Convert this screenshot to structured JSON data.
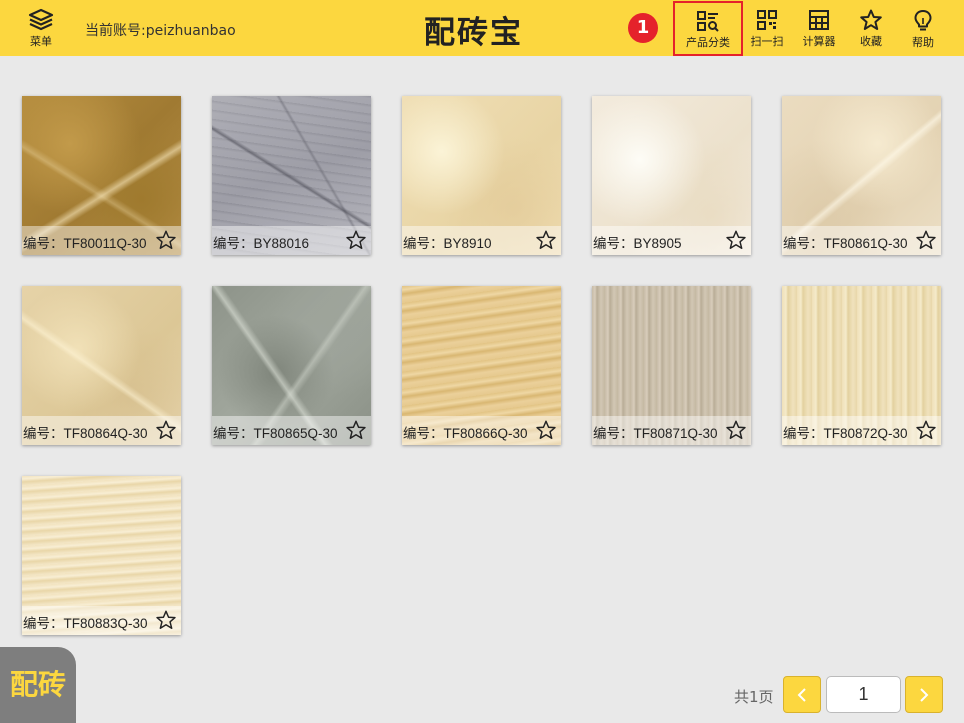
{
  "header": {
    "menu_label": "菜单",
    "account_text": "当前账号:peizhuanbao",
    "app_title": "配砖宝",
    "step_badge": "1",
    "tools": [
      {
        "label": "产品分类",
        "icon": "category-search-icon"
      },
      {
        "label": "扫一扫",
        "icon": "qr-scan-icon"
      },
      {
        "label": "计算器",
        "icon": "calculator-icon"
      },
      {
        "label": "收藏",
        "icon": "star-icon"
      },
      {
        "label": "帮助",
        "icon": "lightbulb-icon"
      }
    ],
    "highlight_color": "#e5222b",
    "bar_color": "#fcd73f"
  },
  "products": [
    {
      "code": "编号：TF80011Q-30",
      "texture": "dark-gold-marble"
    },
    {
      "code": "编号：BY88016",
      "texture": "grey-veined-marble"
    },
    {
      "code": "编号：BY8910",
      "texture": "cream-marble"
    },
    {
      "code": "编号：BY8905",
      "texture": "light-cream-marble"
    },
    {
      "code": "编号：TF80861Q-30",
      "texture": "beige-marble"
    },
    {
      "code": "编号：TF80864Q-30",
      "texture": "beige-crema-marble"
    },
    {
      "code": "编号：TF80865Q-30",
      "texture": "grey-green-marble"
    },
    {
      "code": "编号：TF80866Q-30",
      "texture": "yellow-travertine"
    },
    {
      "code": "编号：TF80871Q-30",
      "texture": "grey-wood-grain-stone"
    },
    {
      "code": "编号：TF80872Q-30",
      "texture": "cream-wood-grain-stone"
    },
    {
      "code": "编号：TF80883Q-30",
      "texture": "cream-travertine"
    }
  ],
  "float_logo": "配砖",
  "pagination": {
    "total_label": "共1页",
    "current_page": "1",
    "prev_icon": "chevron-left-icon",
    "next_icon": "chevron-right-icon"
  }
}
